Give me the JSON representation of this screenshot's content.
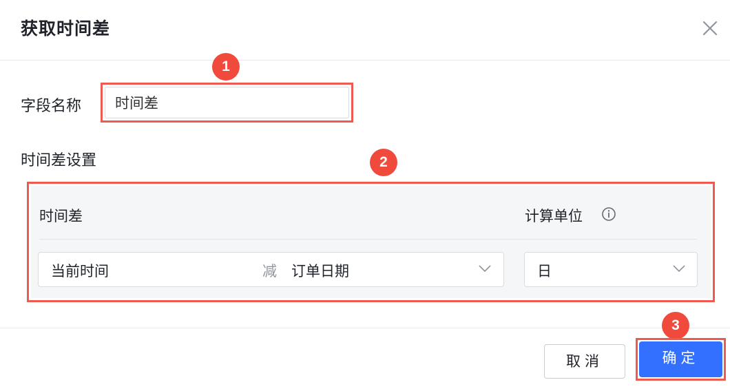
{
  "dialog": {
    "title": "获取时间差",
    "close_icon": "close-icon"
  },
  "field": {
    "label": "字段名称",
    "value": "时间差"
  },
  "section": {
    "label": "时间差设置",
    "col_diff": "时间差",
    "col_unit": "计算单位",
    "info_icon": "info-icon",
    "start_value": "当前时间",
    "operator": "减",
    "end_value": "订单日期",
    "unit_value": "日"
  },
  "badges": [
    "1",
    "2",
    "3"
  ],
  "footer": {
    "cancel_label": "取消",
    "ok_label": "确定"
  },
  "colors": {
    "highlight": "#ee5a4f",
    "badge": "#ef4a3c",
    "primary": "#3370ff"
  }
}
